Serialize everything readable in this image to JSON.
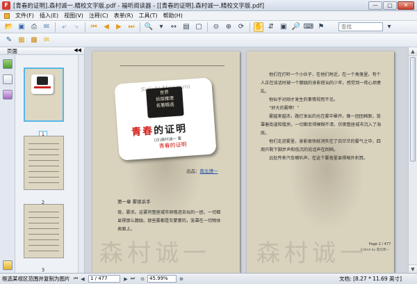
{
  "window": {
    "title": "[青春的证明].森村诚一.精校文字版.pdf - 福听阅读器 - [[青春的证明].森村诚一.精校文字版.pdf]"
  },
  "menu": {
    "items": [
      "文件(F)",
      "插入(E)",
      "视图(V)",
      "注释(C)",
      "表单(R)",
      "工具(T)",
      "帮助(H)"
    ]
  },
  "toolbar": {
    "search_placeholder": "查找"
  },
  "left_panel": {
    "header": "页面",
    "thumbnails": [
      "1",
      "2",
      "3"
    ]
  },
  "left_page": {
    "cover": {
      "script": "Seiichi Morimura",
      "badge_lines": [
        "世界",
        "侦探推理",
        "名著精选"
      ],
      "title_red": "青春",
      "title_black": "的证明",
      "author": "[日]森村诚一  著",
      "subtitle": "青春的证明"
    },
    "editor_label": "出品：",
    "editor_name": "南北博一",
    "chapter": "第一章  雾夜杀手",
    "text": "夜，雾浓。这雾将整座城市吞噬进去似的一团，一切都显得那么朦胧。那些雾都是灰蒙蒙的，笼罩在一切物体表面上。",
    "watermark": "森村诚一"
  },
  "right_page": {
    "paragraphs": [
      "他们在打听一个小伙子，在他们附近，在一个角落里，有个人正在谈话时被一个朦胧的身影搭讪的少年，感觉到一阵心烦意乱。",
      "他似乎对刚才发生的事情视而不见。",
      "“好大的雾啊！”",
      "雾越来越浓，路灯发出的光在雾中晕开，像一团团棉絮。笼罩着街道和楼房，一切都变得模糊不清，仿佛整座城市沉入了海底。",
      "他们走进雾里，身影很快就消失在了白茫茫的雾气之中，四周只剩下脚步声和低沉的说话声在回响。",
      "远处传来汽车喇叭声，在这个雾夜里显得格外刺耳。"
    ],
    "page_label": "Page 2 / 477",
    "footer": "Edited by 南北博一",
    "watermark": "森村诚一"
  },
  "status": {
    "hint": "框选某视区范围并复制为图片",
    "page": "1 / 477",
    "zoom": "45.99%",
    "doc_size": "文档: [8.27 * 11.69 英寸]"
  }
}
